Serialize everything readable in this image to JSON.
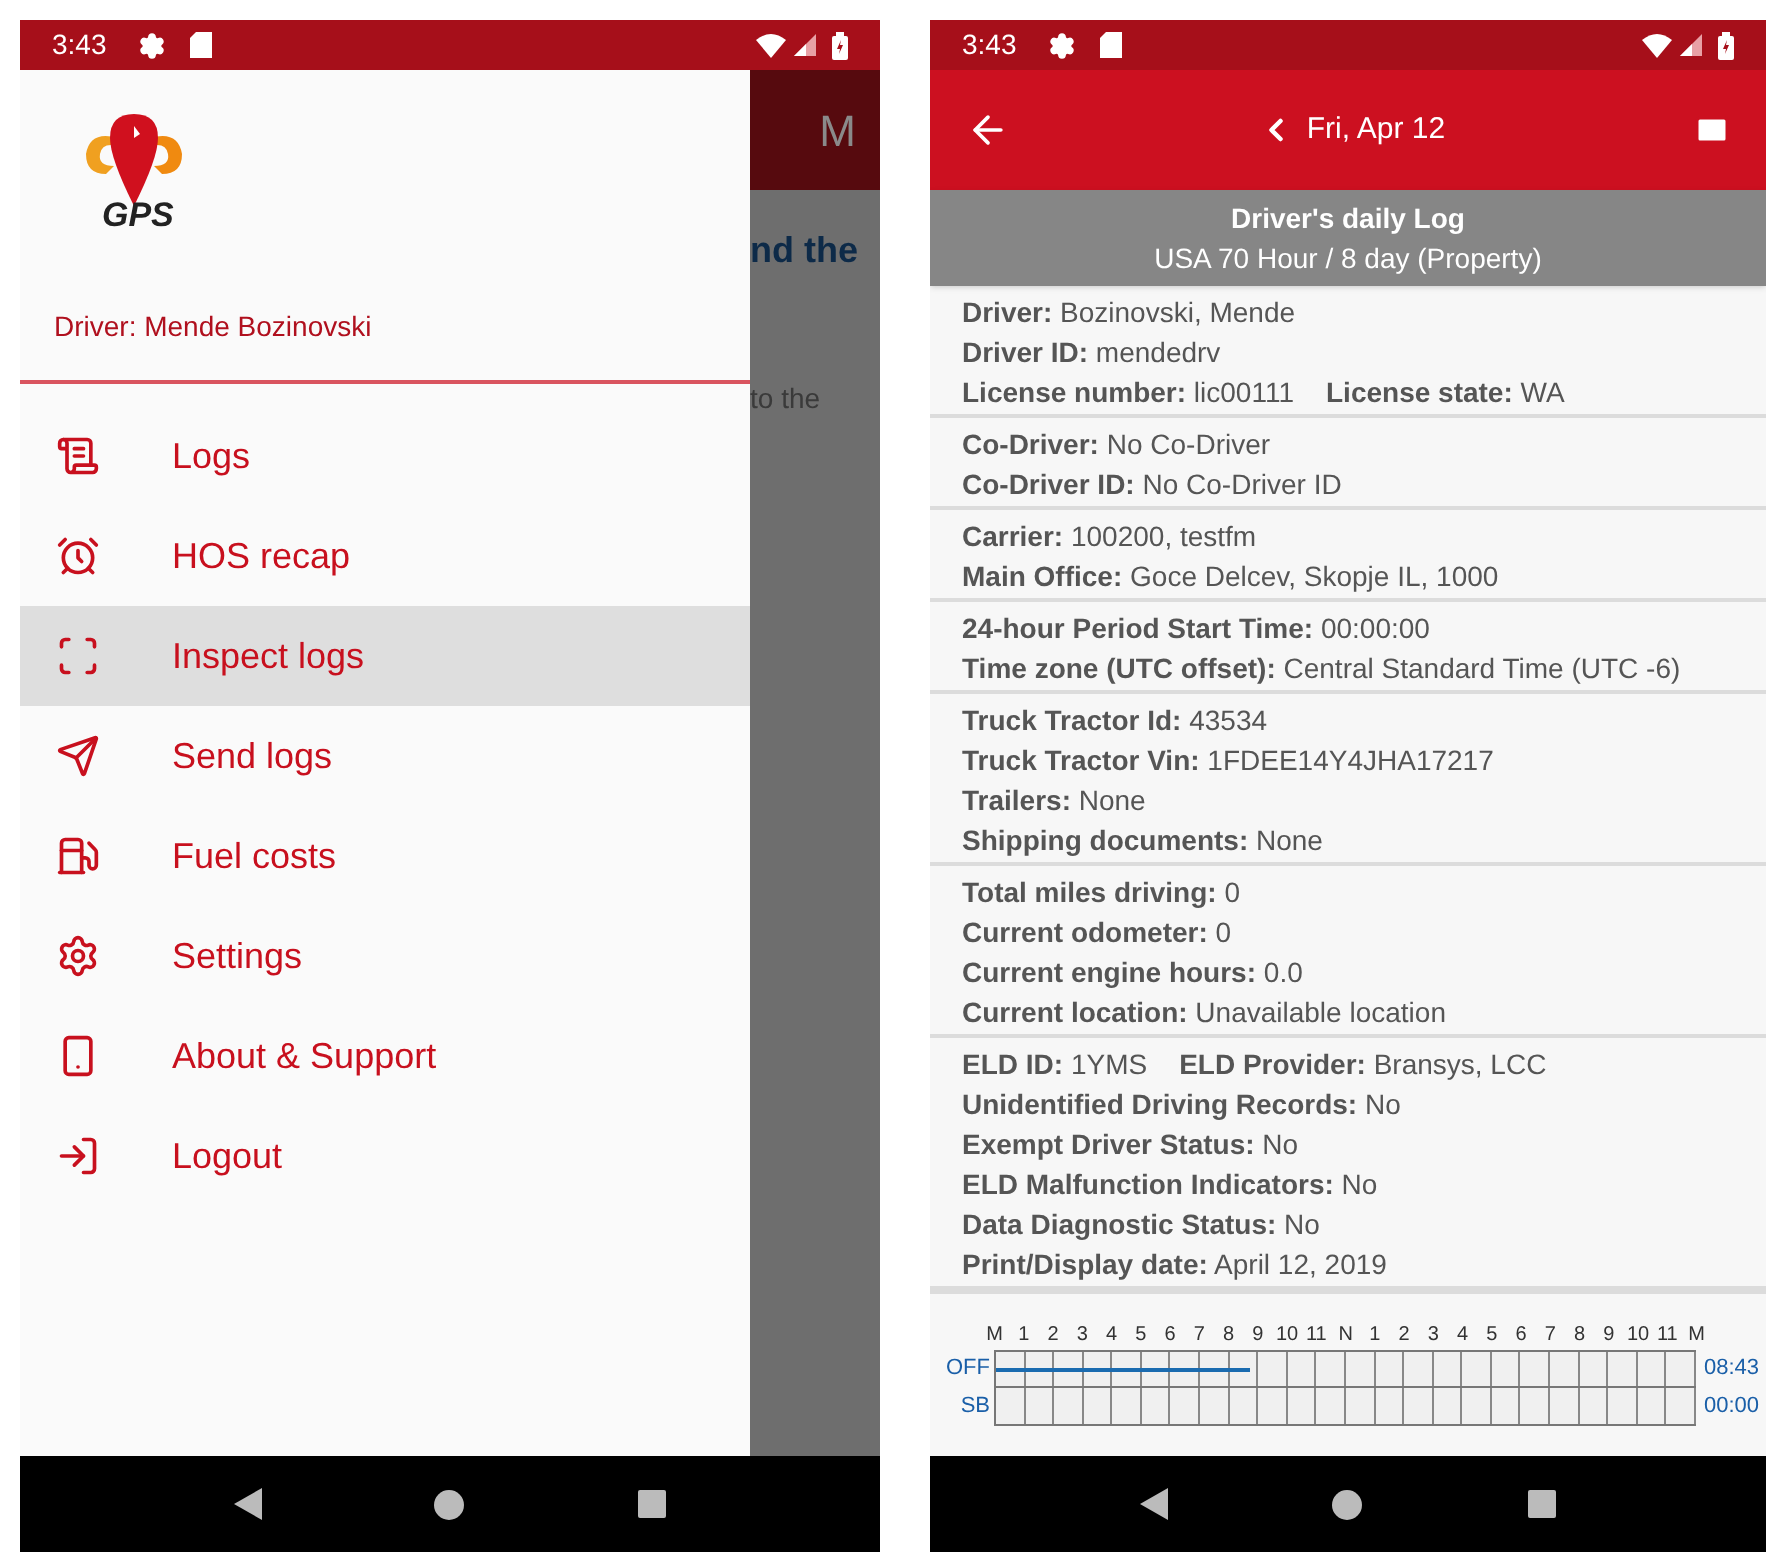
{
  "left_screen": {
    "status_bar": {
      "time": "3:43"
    },
    "background_app": {
      "header_letter": "M",
      "text_1": "nd the",
      "text_2": "to the"
    },
    "drawer": {
      "logo_text": "GPS",
      "driver": "Driver: Mende Bozinovski",
      "items": [
        {
          "label": "Logs",
          "selected": false
        },
        {
          "label": "HOS recap",
          "selected": false
        },
        {
          "label": "Inspect logs",
          "selected": true
        },
        {
          "label": "Send logs",
          "selected": false
        },
        {
          "label": "Fuel costs",
          "selected": false
        },
        {
          "label": "Settings",
          "selected": false
        },
        {
          "label": "About & Support",
          "selected": false
        },
        {
          "label": "Logout",
          "selected": false
        }
      ]
    }
  },
  "right_screen": {
    "status_bar": {
      "time": "3:43"
    },
    "app_bar": {
      "date": "Fri, Apr 12"
    },
    "log_header": {
      "title": "Driver's daily Log",
      "subtitle": "USA 70 Hour / 8 day (Property)"
    },
    "sections": [
      {
        "lines": [
          [
            "**Driver:** Bozinovski, Mende"
          ],
          [
            "**Driver ID:** mendedrv"
          ],
          [
            "**License number:** lic00111",
            "**License state:** WA"
          ]
        ]
      },
      {
        "lines": [
          [
            "**Co-Driver:** No Co-Driver"
          ],
          [
            "**Co-Driver ID:** No Co-Driver ID"
          ]
        ]
      },
      {
        "lines": [
          [
            "**Carrier:** 100200, testfm"
          ],
          [
            "**Main Office:** Goce Delcev, Skopje IL, 1000"
          ]
        ]
      },
      {
        "lines": [
          [
            "**24-hour Period Start Time:** 00:00:00"
          ],
          [
            "**Time zone (UTC offset):** Central Standard Time (UTC -6)"
          ]
        ]
      },
      {
        "lines": [
          [
            "**Truck Tractor Id:** 43534"
          ],
          [
            "**Truck Tractor Vin:** 1FDEE14Y4JHA17217"
          ],
          [
            "**Trailers:** None"
          ],
          [
            "**Shipping documents:** None"
          ]
        ]
      },
      {
        "lines": [
          [
            "**Total miles driving:** 0"
          ],
          [
            "**Current odometer:** 0"
          ],
          [
            "**Current engine hours:** 0.0"
          ],
          [
            "**Current location:** Unavailable location"
          ]
        ]
      },
      {
        "lines": [
          [
            "**ELD ID:** 1YMS",
            "**ELD Provider:** Bransys, LCC"
          ],
          [
            "**Unidentified Driving Records:** No"
          ],
          [
            "**Exempt Driver Status:** No"
          ],
          [
            "**ELD Malfunction Indicators:** No"
          ],
          [
            "**Data Diagnostic Status:** No"
          ],
          [
            "**Print/Display date:** April 12, 2019"
          ]
        ]
      }
    ],
    "graph": {
      "hours": [
        "M",
        "1",
        "2",
        "3",
        "4",
        "5",
        "6",
        "7",
        "8",
        "9",
        "10",
        "11",
        "N",
        "1",
        "2",
        "3",
        "4",
        "5",
        "6",
        "7",
        "8",
        "9",
        "10",
        "11",
        "M"
      ],
      "rows": [
        {
          "label": "OFF",
          "total": "08:43",
          "level": 0.363
        },
        {
          "label": "SB",
          "total": "00:00"
        }
      ]
    }
  }
}
